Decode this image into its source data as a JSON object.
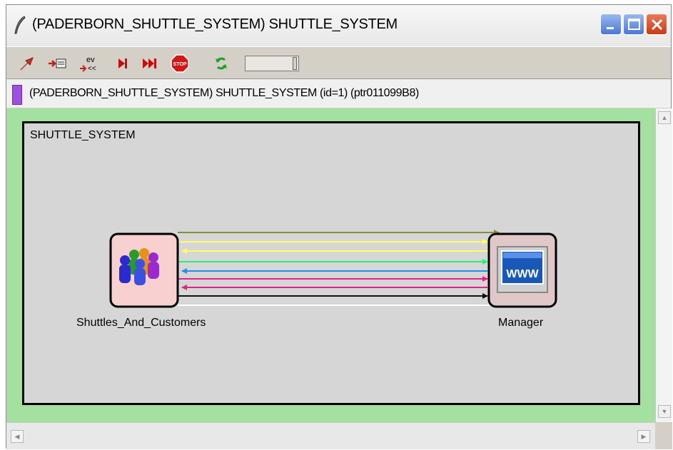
{
  "window": {
    "title": "(PADERBORN_SHUTTLE_SYSTEM) SHUTTLE_SYSTEM"
  },
  "pathbar": {
    "text": "(PADERBORN_SHUTTLE_SYSTEM) SHUTTLE_SYSTEM  (id=1)  (ptr011099B8)",
    "marker_color": "#a050e0"
  },
  "model": {
    "title": "SHUTTLE_SYSTEM",
    "nodes": [
      {
        "label": "Shuttles_And_Customers",
        "icon": "people-group-icon"
      },
      {
        "label": "Manager",
        "icon": "www-monitor-icon"
      }
    ]
  },
  "toolbar": {
    "icons": [
      "red-arrow-icon",
      "insert-event-icon",
      "event-history-icon",
      "step-icon",
      "fast-forward-icon",
      "stop-icon",
      "refresh-icon"
    ]
  },
  "colors": {
    "background": "#a4e0a0",
    "model_box": "#d6d6d6"
  }
}
